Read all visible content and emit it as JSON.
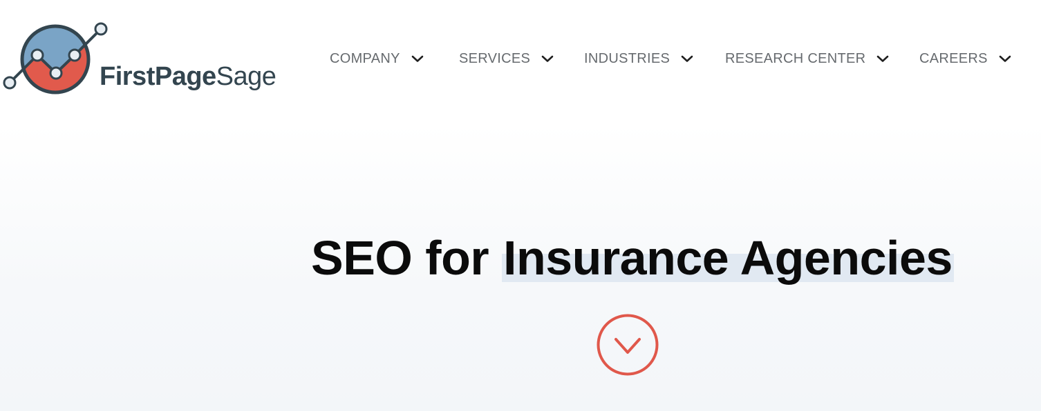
{
  "header": {
    "logo": {
      "text_bold": "FirstPage",
      "text_light": "Sage",
      "icon": "chart-circle-logo-icon"
    },
    "nav": [
      {
        "label": "COMPANY",
        "icon": "chevron-down-icon"
      },
      {
        "label": "SERVICES",
        "icon": "chevron-down-icon"
      },
      {
        "label": "INDUSTRIES",
        "icon": "chevron-down-icon"
      },
      {
        "label": "RESEARCH CENTER",
        "icon": "chevron-down-icon"
      },
      {
        "label": "CAREERS",
        "icon": "chevron-down-icon"
      }
    ]
  },
  "hero": {
    "title_prefix": "SEO for ",
    "title_highlight": "Insurance Agencies",
    "scroll_icon": "circle-chevron-down-icon"
  },
  "colors": {
    "logo_blue": "#7aa4c6",
    "logo_red": "#e15a4c",
    "logo_dark": "#33454f",
    "nav_text": "#666a6e",
    "title_text": "#0b0b0b",
    "highlight": "#e1e9f2",
    "accent_red": "#e0584b"
  }
}
